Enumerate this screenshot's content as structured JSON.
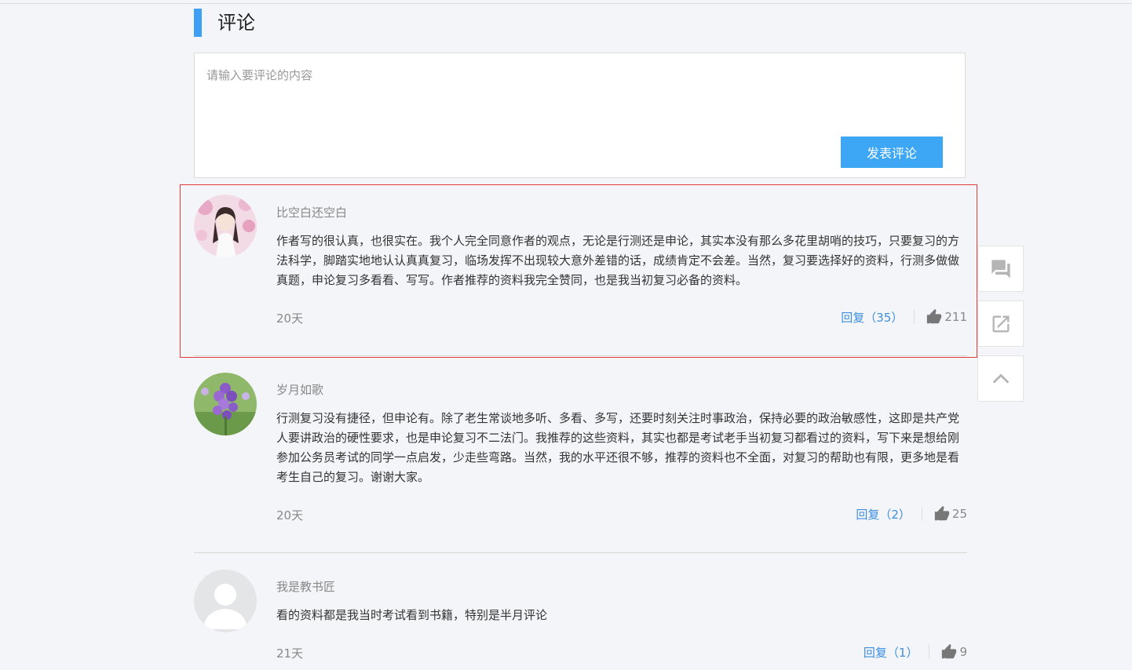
{
  "section": {
    "title": "评论"
  },
  "compose": {
    "placeholder": "请输入要评论的内容",
    "submit_label": "发表评论"
  },
  "comments": [
    {
      "author": "比空白还空白",
      "content": "作者写的很认真，也很实在。我个人完全同意作者的观点，无论是行测还是申论，其实本没有那么多花里胡哨的技巧，只要复习的方法科学，脚踏实地地认认真真复习，临场发挥不出现较大意外差错的话，成绩肯定不会差。当然，复习要选择好的资料，行测多做做真题，申论复习多看看、写写。作者推荐的资料我完全赞同，也是我当初复习必备的资料。",
      "time": "20天",
      "reply_label": "回复（35）",
      "likes": "211"
    },
    {
      "author": "岁月如歌",
      "content": "行测复习没有捷径，但申论有。除了老生常谈地多听、多看、多写，还要时刻关注时事政治，保持必要的政治敏感性，这即是共产党人要讲政治的硬性要求，也是申论复习不二法门。我推荐的这些资料，其实也都是考试老手当初复习都看过的资料，写下来是想给刚参加公务员考试的同学一点启发，少走些弯路。当然，我的水平还很不够，推荐的资料也不全面，对复习的帮助也有限，更多地是看考生自己的复习。谢谢大家。",
      "time": "20天",
      "reply_label": "回复（2）",
      "likes": "25"
    },
    {
      "author": "我是教书匠",
      "content": "看的资料都是我当时考试看到书籍，特别是半月评论",
      "time": "21天",
      "reply_label": "回复（1）",
      "likes": "9"
    }
  ],
  "float_toolbar": {
    "icons": [
      "comment-icon",
      "share-icon",
      "back-to-top-icon"
    ]
  },
  "colors": {
    "accent": "#3d9ff5",
    "button": "#3da7f5",
    "highlight": "#e03a3a",
    "link": "#3d8fe0"
  }
}
